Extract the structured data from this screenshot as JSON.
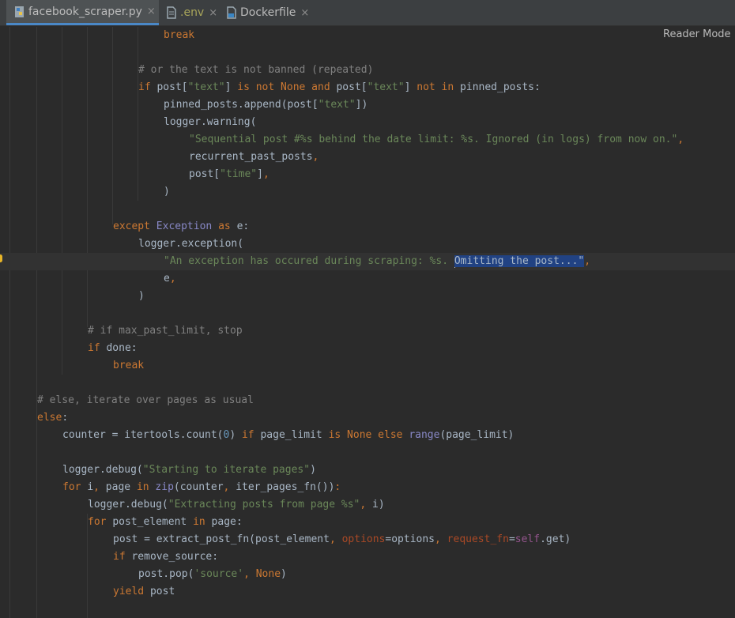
{
  "tabs": [
    {
      "label": "facebook_scraper.py",
      "icon": "python-file-icon",
      "active": true
    },
    {
      "label": ".env",
      "icon": "text-file-icon",
      "active": false
    },
    {
      "label": "Dockerfile",
      "icon": "docker-file-icon",
      "active": false
    }
  ],
  "tab_close_glyph": "×",
  "reader_mode_label": "Reader Mode",
  "selection_text": "Omitting the post...",
  "colors": {
    "background": "#2b2b2b",
    "keyword": "#cc7832",
    "string": "#6a8759",
    "comment": "#808080",
    "builtin": "#8888c6",
    "number": "#6897bb",
    "selection": "#214283",
    "active_tab_underline": "#4a88c7"
  },
  "code_lines": [
    [
      [
        "kw",
        "break"
      ]
    ],
    [],
    [
      [
        "cm",
        "# or the text is not banned (repeated)"
      ]
    ],
    [
      [
        "kw",
        "if "
      ],
      [
        "t",
        "post["
      ],
      [
        "str",
        "\"text\""
      ],
      [
        "t",
        "] "
      ],
      [
        "kw",
        "is not None and "
      ],
      [
        "t",
        "post["
      ],
      [
        "str",
        "\"text\""
      ],
      [
        "t",
        "] "
      ],
      [
        "kw",
        "not in "
      ],
      [
        "t",
        "pinned_posts:"
      ]
    ],
    [
      [
        "t",
        "pinned_posts.append(post["
      ],
      [
        "str",
        "\"text\""
      ],
      [
        "t",
        "])"
      ]
    ],
    [
      [
        "t",
        "logger.warning("
      ]
    ],
    [
      [
        "str",
        "\"Sequential post #%s behind the date limit: %s. Ignored (in logs) from now on.\""
      ],
      [
        "kw",
        ","
      ]
    ],
    [
      [
        "t",
        "recurrent_past_posts"
      ],
      [
        "kw",
        ","
      ]
    ],
    [
      [
        "t",
        "post["
      ],
      [
        "str",
        "\"time\""
      ],
      [
        "t",
        "]"
      ],
      [
        "kw",
        ","
      ]
    ],
    [
      [
        "t",
        ")"
      ]
    ],
    [],
    [
      [
        "kw",
        "except "
      ],
      [
        "bi",
        "Exception "
      ],
      [
        "kw",
        "as "
      ],
      [
        "t",
        "e:"
      ]
    ],
    [
      [
        "t",
        "logger.exception("
      ]
    ],
    [
      [
        "str",
        "\"An exception has occured during scraping: %s. "
      ],
      [
        "cursor",
        ""
      ],
      [
        "sel",
        "Omitting the post...\""
      ],
      [
        "kw",
        ","
      ]
    ],
    [
      [
        "t",
        "e"
      ],
      [
        "kw",
        ","
      ]
    ],
    [
      [
        "t",
        ")"
      ]
    ],
    [],
    [
      [
        "cm",
        "# if max_past_limit, stop"
      ]
    ],
    [
      [
        "kw",
        "if "
      ],
      [
        "t",
        "done:"
      ]
    ],
    [
      [
        "kw",
        "break"
      ]
    ],
    [],
    [
      [
        "cm",
        "# else, iterate over pages as usual"
      ]
    ],
    [
      [
        "kw",
        "else"
      ],
      [
        "t",
        ":"
      ]
    ],
    [
      [
        "t",
        "counter = itertools.count("
      ],
      [
        "num",
        "0"
      ],
      [
        "t",
        ") "
      ],
      [
        "kw",
        "if "
      ],
      [
        "t",
        "page_limit "
      ],
      [
        "kw",
        "is None else "
      ],
      [
        "bi",
        "range"
      ],
      [
        "t",
        "(page_limit)"
      ]
    ],
    [],
    [
      [
        "t",
        "logger.debug("
      ],
      [
        "str",
        "\"Starting to iterate pages\""
      ],
      [
        "t",
        ")"
      ]
    ],
    [
      [
        "kw",
        "for "
      ],
      [
        "t",
        "i"
      ],
      [
        "kw",
        ", "
      ],
      [
        "t",
        "page "
      ],
      [
        "kw",
        "in "
      ],
      [
        "bi",
        "zip"
      ],
      [
        "t",
        "(counter"
      ],
      [
        "kw",
        ", "
      ],
      [
        "t",
        "iter_pages_fn())"
      ],
      [
        "kw",
        ":"
      ]
    ],
    [
      [
        "t",
        "logger.debug("
      ],
      [
        "str",
        "\"Extracting posts from page %s\""
      ],
      [
        "kw",
        ", "
      ],
      [
        "t",
        "i)"
      ]
    ],
    [
      [
        "kw",
        "for "
      ],
      [
        "t",
        "post_element "
      ],
      [
        "kw",
        "in "
      ],
      [
        "t",
        "page:"
      ]
    ],
    [
      [
        "t",
        "post = extract_post_fn(post_element"
      ],
      [
        "kw",
        ", "
      ],
      [
        "param",
        "options"
      ],
      [
        "t",
        "=options"
      ],
      [
        "kw",
        ", "
      ],
      [
        "param",
        "request_fn"
      ],
      [
        "t",
        "="
      ],
      [
        "self",
        "self"
      ],
      [
        "t",
        ".get)"
      ]
    ],
    [
      [
        "kw",
        "if "
      ],
      [
        "t",
        "remove_source:"
      ]
    ],
    [
      [
        "t",
        "post.pop("
      ],
      [
        "str",
        "'source'"
      ],
      [
        "kw",
        ", "
      ],
      [
        "kw",
        "None"
      ],
      [
        "t",
        ")"
      ]
    ],
    [
      [
        "kw",
        "yield "
      ],
      [
        "t",
        "post"
      ]
    ]
  ]
}
